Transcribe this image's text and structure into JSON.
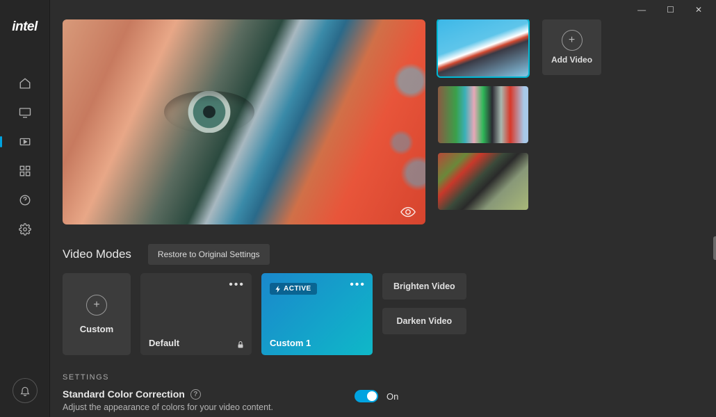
{
  "brand": "intel",
  "titlebar": {
    "minimize": "—",
    "maximize": "☐",
    "close": "✕"
  },
  "sidebar": {
    "items": [
      {
        "name": "home"
      },
      {
        "name": "display"
      },
      {
        "name": "video",
        "active": true
      },
      {
        "name": "apps"
      },
      {
        "name": "help"
      },
      {
        "name": "settings"
      }
    ]
  },
  "add_video_label": "Add Video",
  "modes": {
    "title": "Video Modes",
    "restore_label": "Restore to Original Settings",
    "custom_label": "Custom",
    "default_label": "Default",
    "active_badge": "ACTIVE",
    "custom1_label": "Custom 1",
    "brighten_label": "Brighten Video",
    "darken_label": "Darken Video"
  },
  "settings": {
    "heading": "SETTINGS",
    "scc_title": "Standard Color Correction",
    "scc_desc": "Adjust the appearance of colors for your video content.",
    "toggle_state": "On"
  }
}
